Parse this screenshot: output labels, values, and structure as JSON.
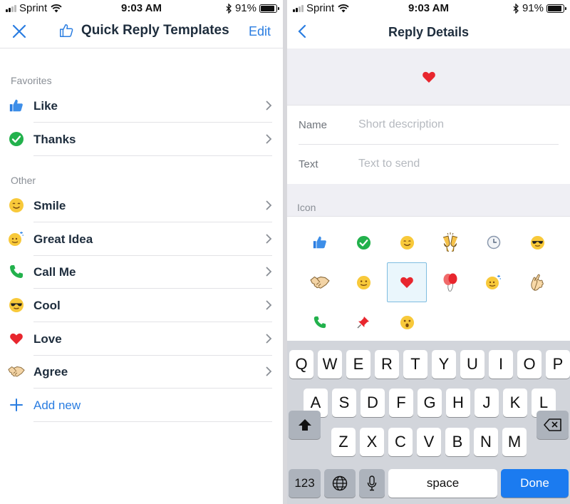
{
  "status": {
    "carrier": "Sprint",
    "time": "9:03 AM",
    "battery": "91%",
    "battery_level": 0.91
  },
  "left": {
    "title": "Quick Reply Templates",
    "edit_label": "Edit",
    "favorites_label": "Favorites",
    "other_label": "Other",
    "favorites": [
      {
        "label": "Like",
        "icon": "thumbs-up-icon"
      },
      {
        "label": "Thanks",
        "icon": "check-circle-icon"
      }
    ],
    "other": [
      {
        "label": "Smile",
        "icon": "smile-icon"
      },
      {
        "label": "Great Idea",
        "icon": "idea-face-icon"
      },
      {
        "label": "Call Me",
        "icon": "phone-icon"
      },
      {
        "label": "Cool",
        "icon": "sunglasses-icon"
      },
      {
        "label": "Love",
        "icon": "heart-icon"
      },
      {
        "label": "Agree",
        "icon": "handshake-icon"
      }
    ],
    "add_new_label": "Add new"
  },
  "right": {
    "title": "Reply Details",
    "name_label": "Name",
    "name_placeholder": "Short description",
    "text_label": "Text",
    "text_placeholder": "Text to send",
    "icon_section_label": "Icon",
    "icons": [
      "thumbs-up-icon",
      "check-circle-icon",
      "smile-icon",
      "cheers-icon",
      "clock-icon",
      "sunglasses-icon",
      "handshake-icon",
      "grin-icon",
      "heart-icon",
      "balloons-icon",
      "idea-face-icon",
      "ok-hand-icon",
      "phone-icon",
      "pin-icon",
      "surprised-icon"
    ],
    "selected_icon": "heart-icon"
  },
  "keyboard": {
    "row1": [
      "Q",
      "W",
      "E",
      "R",
      "T",
      "Y",
      "U",
      "I",
      "O",
      "P"
    ],
    "row2": [
      "A",
      "S",
      "D",
      "F",
      "G",
      "H",
      "J",
      "K",
      "L"
    ],
    "row3": [
      "Z",
      "X",
      "C",
      "V",
      "B",
      "N",
      "M"
    ],
    "numbers_label": "123",
    "space_label": "space",
    "done_label": "Done"
  },
  "colors": {
    "accent": "#2a7de1",
    "done": "#1b7bf0",
    "heart": "#e8262e",
    "check": "#22b14c"
  }
}
